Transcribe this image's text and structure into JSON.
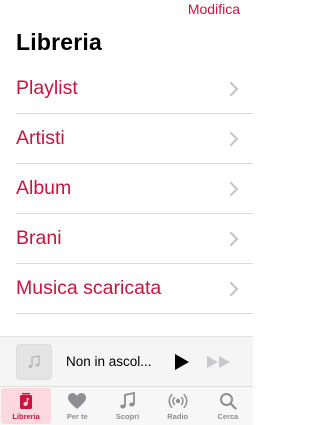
{
  "header": {
    "edit_label": "Modifica",
    "title": "Libreria"
  },
  "library": {
    "items": [
      {
        "label": "Playlist"
      },
      {
        "label": "Artisti"
      },
      {
        "label": "Album"
      },
      {
        "label": "Brani"
      },
      {
        "label": "Musica scaricata"
      }
    ]
  },
  "player": {
    "now_playing": "Non in ascol..."
  },
  "tabs": [
    {
      "label": "Libreria",
      "icon": "library-icon",
      "active": true
    },
    {
      "label": "Per te",
      "icon": "heart-icon",
      "active": false
    },
    {
      "label": "Scopri",
      "icon": "music-note-icon",
      "active": false
    },
    {
      "label": "Radio",
      "icon": "radio-icon",
      "active": false
    },
    {
      "label": "Cerca",
      "icon": "search-icon",
      "active": false
    }
  ],
  "colors": {
    "accent": "#c8153f",
    "tab_inactive": "#8e8e93",
    "active_tab_bg": "#fbd9df"
  }
}
